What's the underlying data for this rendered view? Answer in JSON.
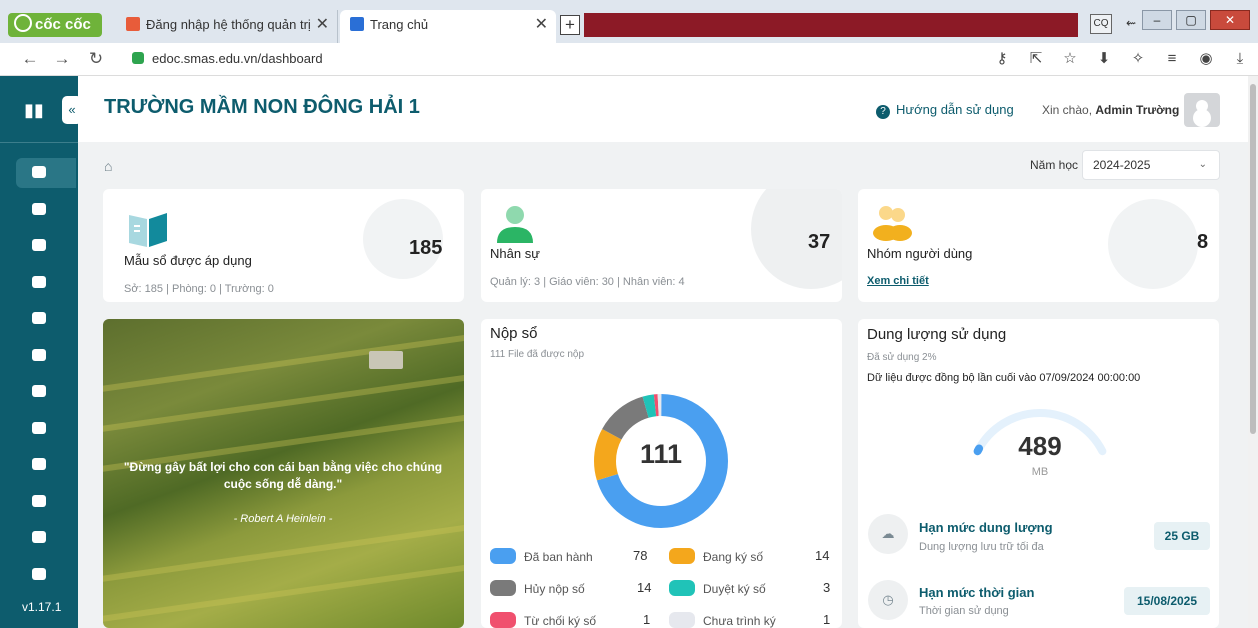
{
  "browser": {
    "brand": "cốc cốc",
    "tabs": [
      {
        "title": "Đăng nhập hệ thống quản trị"
      },
      {
        "title": "Trang chủ"
      }
    ],
    "new_tab": "+",
    "url": "edoc.smas.edu.vn/dashboard",
    "ext_badge": "CQ"
  },
  "sidebar": {
    "version": "v1.17.1",
    "items": [
      "home",
      "upload",
      "download",
      "document-search",
      "folder",
      "file-check",
      "check-circle",
      "file-text",
      "cloud",
      "book",
      "settings",
      "list"
    ]
  },
  "header": {
    "school_name": "TRƯỜNG MẦM NON ĐÔNG HẢI 1",
    "help": "Hướng dẫn sử dụng",
    "greeting_prefix": "Xin chào,",
    "user": "Admin Trường"
  },
  "filter": {
    "year_label": "Năm học",
    "year_value": "2024-2025"
  },
  "stats": [
    {
      "title": "Mẫu sổ được áp dụng",
      "value": "185",
      "sub": "Sở: 185 | Phòng: 0 | Trường: 0"
    },
    {
      "title": "Nhân sự",
      "value": "37",
      "sub": "Quản lý: 3 | Giáo viên: 30 | Nhân viên: 4"
    },
    {
      "title": "Nhóm người dùng",
      "value": "8",
      "link": "Xem chi tiết"
    }
  ],
  "quote": {
    "text": "\"Đừng gây bất lợi cho con cái bạn bằng việc cho chúng cuộc sống dễ dàng.\"",
    "author": "- Robert A Heinlein -"
  },
  "submission": {
    "title": "Nộp sổ",
    "subtitle": "111 File đã được nộp",
    "total": "111",
    "legend": [
      {
        "label": "Đã ban hành",
        "value": "78",
        "color": "#4a9ff0"
      },
      {
        "label": "Đang ký số",
        "value": "14",
        "color": "#f4a71c"
      },
      {
        "label": "Hủy nộp số",
        "value": "14",
        "color": "#7a7a7a"
      },
      {
        "label": "Duyệt ký số",
        "value": "3",
        "color": "#20c3b8"
      },
      {
        "label": "Từ chối ký số",
        "value": "1",
        "color": "#f0506e"
      },
      {
        "label": "Chưa trình ký",
        "value": "1",
        "color": "#e6e8ee"
      }
    ]
  },
  "storage": {
    "title": "Dung lượng sử dụng",
    "used_text": "Đã sử dụng 2%",
    "used_fraction": 0.02,
    "sync_text": "Dữ liệu được đồng bộ lần cuối vào 07/09/2024 00:00:00",
    "value": "489",
    "unit": "MB",
    "rows": [
      {
        "title": "Hạn mức dung lượng",
        "sub": "Dung lượng lưu trữ tối đa",
        "badge": "25 GB"
      },
      {
        "title": "Hạn mức thời gian",
        "sub": "Thời gian sử dụng",
        "badge": "15/08/2025"
      }
    ]
  }
}
